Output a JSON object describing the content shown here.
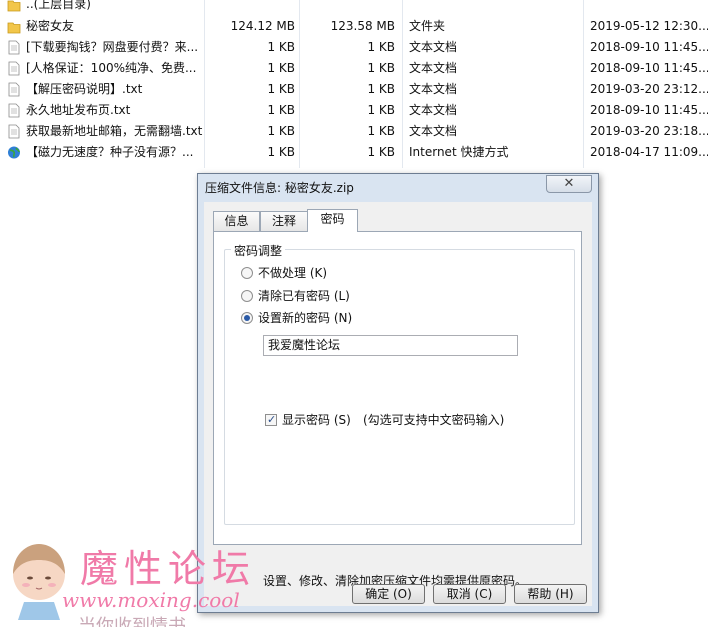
{
  "files": [
    {
      "name": "..(上层目录)",
      "size": "",
      "packed": "",
      "type": "",
      "date": "",
      "icon": "folder-icon"
    },
    {
      "name": "秘密女友",
      "size": "124.12 MB",
      "packed": "123.58 MB",
      "type": "文件夹",
      "date": "2019-05-12 12:30...",
      "icon": "folder-icon"
    },
    {
      "name": "[下载要掏钱？网盘要付费？来...",
      "size": "1 KB",
      "packed": "1 KB",
      "type": "文本文档",
      "date": "2018-09-10 11:45...",
      "icon": "text-file-icon"
    },
    {
      "name": "[人格保证：100%纯净、免费...",
      "size": "1 KB",
      "packed": "1 KB",
      "type": "文本文档",
      "date": "2018-09-10 11:45...",
      "icon": "text-file-icon"
    },
    {
      "name": "【解压密码说明】.txt",
      "size": "1 KB",
      "packed": "1 KB",
      "type": "文本文档",
      "date": "2019-03-20 23:12...",
      "icon": "text-file-icon"
    },
    {
      "name": "永久地址发布页.txt",
      "size": "1 KB",
      "packed": "1 KB",
      "type": "文本文档",
      "date": "2018-09-10 11:45...",
      "icon": "text-file-icon"
    },
    {
      "name": "获取最新地址邮箱，无需翻墙.txt",
      "size": "1 KB",
      "packed": "1 KB",
      "type": "文本文档",
      "date": "2019-03-20 23:18...",
      "icon": "text-file-icon"
    },
    {
      "name": "【磁力无速度？种子没有源？...",
      "size": "1 KB",
      "packed": "1 KB",
      "type": "Internet 快捷方式",
      "date": "2018-04-17 11:09...",
      "icon": "internet-shortcut-icon"
    }
  ],
  "dialog": {
    "title": "压缩文件信息: 秘密女友.zip",
    "close_label": "✕",
    "tabs": [
      "信息",
      "注释",
      "密码"
    ],
    "group_label": "密码调整",
    "options": [
      "不做处理 (K)",
      "清除已有密码 (L)",
      "设置新的密码 (N)"
    ],
    "password_value": "我爱魔性论坛",
    "show_password_label": "显示密码 (S)",
    "show_password_hint": "(勾选可支持中文密码输入)",
    "footer_note": "设置、修改、清除加密压缩文件均需提供原密码。",
    "ok_label": "确定 (O)",
    "cancel_label": "取消 (C)",
    "help_label": "帮助 (H)"
  },
  "watermark": {
    "title": "魔性论坛",
    "url": "www.moxing.cool",
    "bottom_text": "当你收到情书"
  },
  "colors": {
    "folder": "#f2c64a",
    "dialog_frame": "#d9e4f1",
    "radio_selected": "#2b5aa6",
    "watermark": "#f07aa8"
  }
}
